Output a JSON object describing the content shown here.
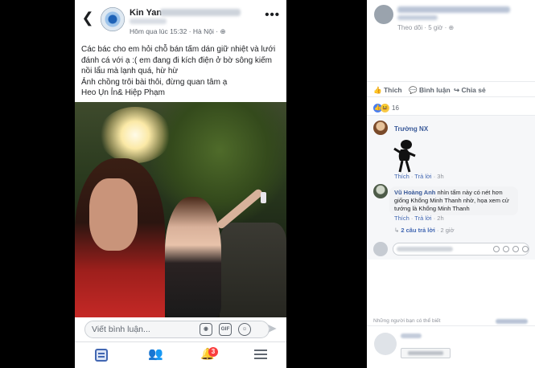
{
  "mobile": {
    "author": "Kin Yan",
    "meta": "Hôm qua lúc 15:32 · Hà Nội · ",
    "post_lines": [
      "Các bác cho em hỏi chỗ bán tấm dán giữ nhiệt và lưới",
      "đánh cá với ạ :( em đang đi kích điện ở bờ sông kiếm",
      "nồi lẩu mà lạnh quá, hừ hừ",
      "Ảnh chồng trôi bài thôi, đừng quan tâm ạ",
      "Heo Ụn Ỉn& Hiệp Phạm"
    ],
    "comment_placeholder": "Viết bình luận...",
    "gif_label": "GIF",
    "notification_count": "3"
  },
  "desktop": {
    "meta": "Theo dõi · 5 giờ · ",
    "actions": {
      "like": "Thích",
      "comment": "Bình luận",
      "share": "Chia sẻ"
    },
    "reaction_count": "16",
    "comments": [
      {
        "name": "Trường NX",
        "actions_like": "Thích",
        "actions_reply": "Trả lời",
        "time": "3h"
      },
      {
        "name": "Vũ Hoàng Anh",
        "text": "nhìn tấm này có nét hơn giống Khổng Minh Thanh nhờ, họa xem cử tướng là Khổng Minh Thanh",
        "actions_like": "Thích",
        "actions_reply": "Trả lời",
        "time": "2h"
      }
    ],
    "replies_link": "2 câu trả lời",
    "replies_time": "2 giờ",
    "suggestions_title": "Những người bạn có thể biết"
  }
}
